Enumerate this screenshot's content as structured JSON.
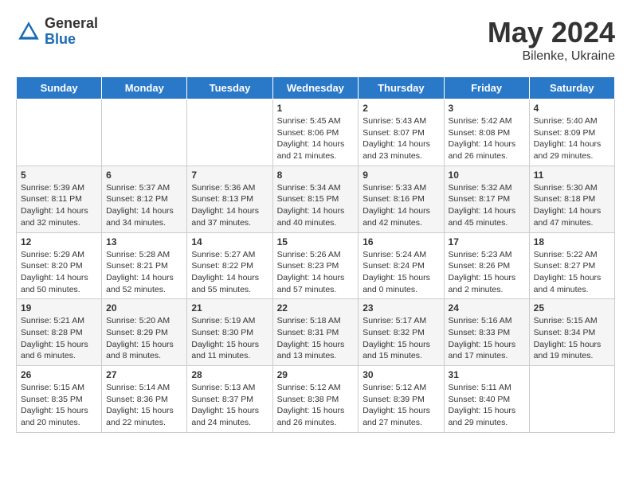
{
  "header": {
    "logo_general": "General",
    "logo_blue": "Blue",
    "month_year": "May 2024",
    "location": "Bilenke, Ukraine"
  },
  "weekdays": [
    "Sunday",
    "Monday",
    "Tuesday",
    "Wednesday",
    "Thursday",
    "Friday",
    "Saturday"
  ],
  "weeks": [
    [
      {
        "day": "",
        "info": ""
      },
      {
        "day": "",
        "info": ""
      },
      {
        "day": "",
        "info": ""
      },
      {
        "day": "1",
        "info": "Sunrise: 5:45 AM\nSunset: 8:06 PM\nDaylight: 14 hours and 21 minutes."
      },
      {
        "day": "2",
        "info": "Sunrise: 5:43 AM\nSunset: 8:07 PM\nDaylight: 14 hours and 23 minutes."
      },
      {
        "day": "3",
        "info": "Sunrise: 5:42 AM\nSunset: 8:08 PM\nDaylight: 14 hours and 26 minutes."
      },
      {
        "day": "4",
        "info": "Sunrise: 5:40 AM\nSunset: 8:09 PM\nDaylight: 14 hours and 29 minutes."
      }
    ],
    [
      {
        "day": "5",
        "info": "Sunrise: 5:39 AM\nSunset: 8:11 PM\nDaylight: 14 hours and 32 minutes."
      },
      {
        "day": "6",
        "info": "Sunrise: 5:37 AM\nSunset: 8:12 PM\nDaylight: 14 hours and 34 minutes."
      },
      {
        "day": "7",
        "info": "Sunrise: 5:36 AM\nSunset: 8:13 PM\nDaylight: 14 hours and 37 minutes."
      },
      {
        "day": "8",
        "info": "Sunrise: 5:34 AM\nSunset: 8:15 PM\nDaylight: 14 hours and 40 minutes."
      },
      {
        "day": "9",
        "info": "Sunrise: 5:33 AM\nSunset: 8:16 PM\nDaylight: 14 hours and 42 minutes."
      },
      {
        "day": "10",
        "info": "Sunrise: 5:32 AM\nSunset: 8:17 PM\nDaylight: 14 hours and 45 minutes."
      },
      {
        "day": "11",
        "info": "Sunrise: 5:30 AM\nSunset: 8:18 PM\nDaylight: 14 hours and 47 minutes."
      }
    ],
    [
      {
        "day": "12",
        "info": "Sunrise: 5:29 AM\nSunset: 8:20 PM\nDaylight: 14 hours and 50 minutes."
      },
      {
        "day": "13",
        "info": "Sunrise: 5:28 AM\nSunset: 8:21 PM\nDaylight: 14 hours and 52 minutes."
      },
      {
        "day": "14",
        "info": "Sunrise: 5:27 AM\nSunset: 8:22 PM\nDaylight: 14 hours and 55 minutes."
      },
      {
        "day": "15",
        "info": "Sunrise: 5:26 AM\nSunset: 8:23 PM\nDaylight: 14 hours and 57 minutes."
      },
      {
        "day": "16",
        "info": "Sunrise: 5:24 AM\nSunset: 8:24 PM\nDaylight: 15 hours and 0 minutes."
      },
      {
        "day": "17",
        "info": "Sunrise: 5:23 AM\nSunset: 8:26 PM\nDaylight: 15 hours and 2 minutes."
      },
      {
        "day": "18",
        "info": "Sunrise: 5:22 AM\nSunset: 8:27 PM\nDaylight: 15 hours and 4 minutes."
      }
    ],
    [
      {
        "day": "19",
        "info": "Sunrise: 5:21 AM\nSunset: 8:28 PM\nDaylight: 15 hours and 6 minutes."
      },
      {
        "day": "20",
        "info": "Sunrise: 5:20 AM\nSunset: 8:29 PM\nDaylight: 15 hours and 8 minutes."
      },
      {
        "day": "21",
        "info": "Sunrise: 5:19 AM\nSunset: 8:30 PM\nDaylight: 15 hours and 11 minutes."
      },
      {
        "day": "22",
        "info": "Sunrise: 5:18 AM\nSunset: 8:31 PM\nDaylight: 15 hours and 13 minutes."
      },
      {
        "day": "23",
        "info": "Sunrise: 5:17 AM\nSunset: 8:32 PM\nDaylight: 15 hours and 15 minutes."
      },
      {
        "day": "24",
        "info": "Sunrise: 5:16 AM\nSunset: 8:33 PM\nDaylight: 15 hours and 17 minutes."
      },
      {
        "day": "25",
        "info": "Sunrise: 5:15 AM\nSunset: 8:34 PM\nDaylight: 15 hours and 19 minutes."
      }
    ],
    [
      {
        "day": "26",
        "info": "Sunrise: 5:15 AM\nSunset: 8:35 PM\nDaylight: 15 hours and 20 minutes."
      },
      {
        "day": "27",
        "info": "Sunrise: 5:14 AM\nSunset: 8:36 PM\nDaylight: 15 hours and 22 minutes."
      },
      {
        "day": "28",
        "info": "Sunrise: 5:13 AM\nSunset: 8:37 PM\nDaylight: 15 hours and 24 minutes."
      },
      {
        "day": "29",
        "info": "Sunrise: 5:12 AM\nSunset: 8:38 PM\nDaylight: 15 hours and 26 minutes."
      },
      {
        "day": "30",
        "info": "Sunrise: 5:12 AM\nSunset: 8:39 PM\nDaylight: 15 hours and 27 minutes."
      },
      {
        "day": "31",
        "info": "Sunrise: 5:11 AM\nSunset: 8:40 PM\nDaylight: 15 hours and 29 minutes."
      },
      {
        "day": "",
        "info": ""
      }
    ]
  ]
}
